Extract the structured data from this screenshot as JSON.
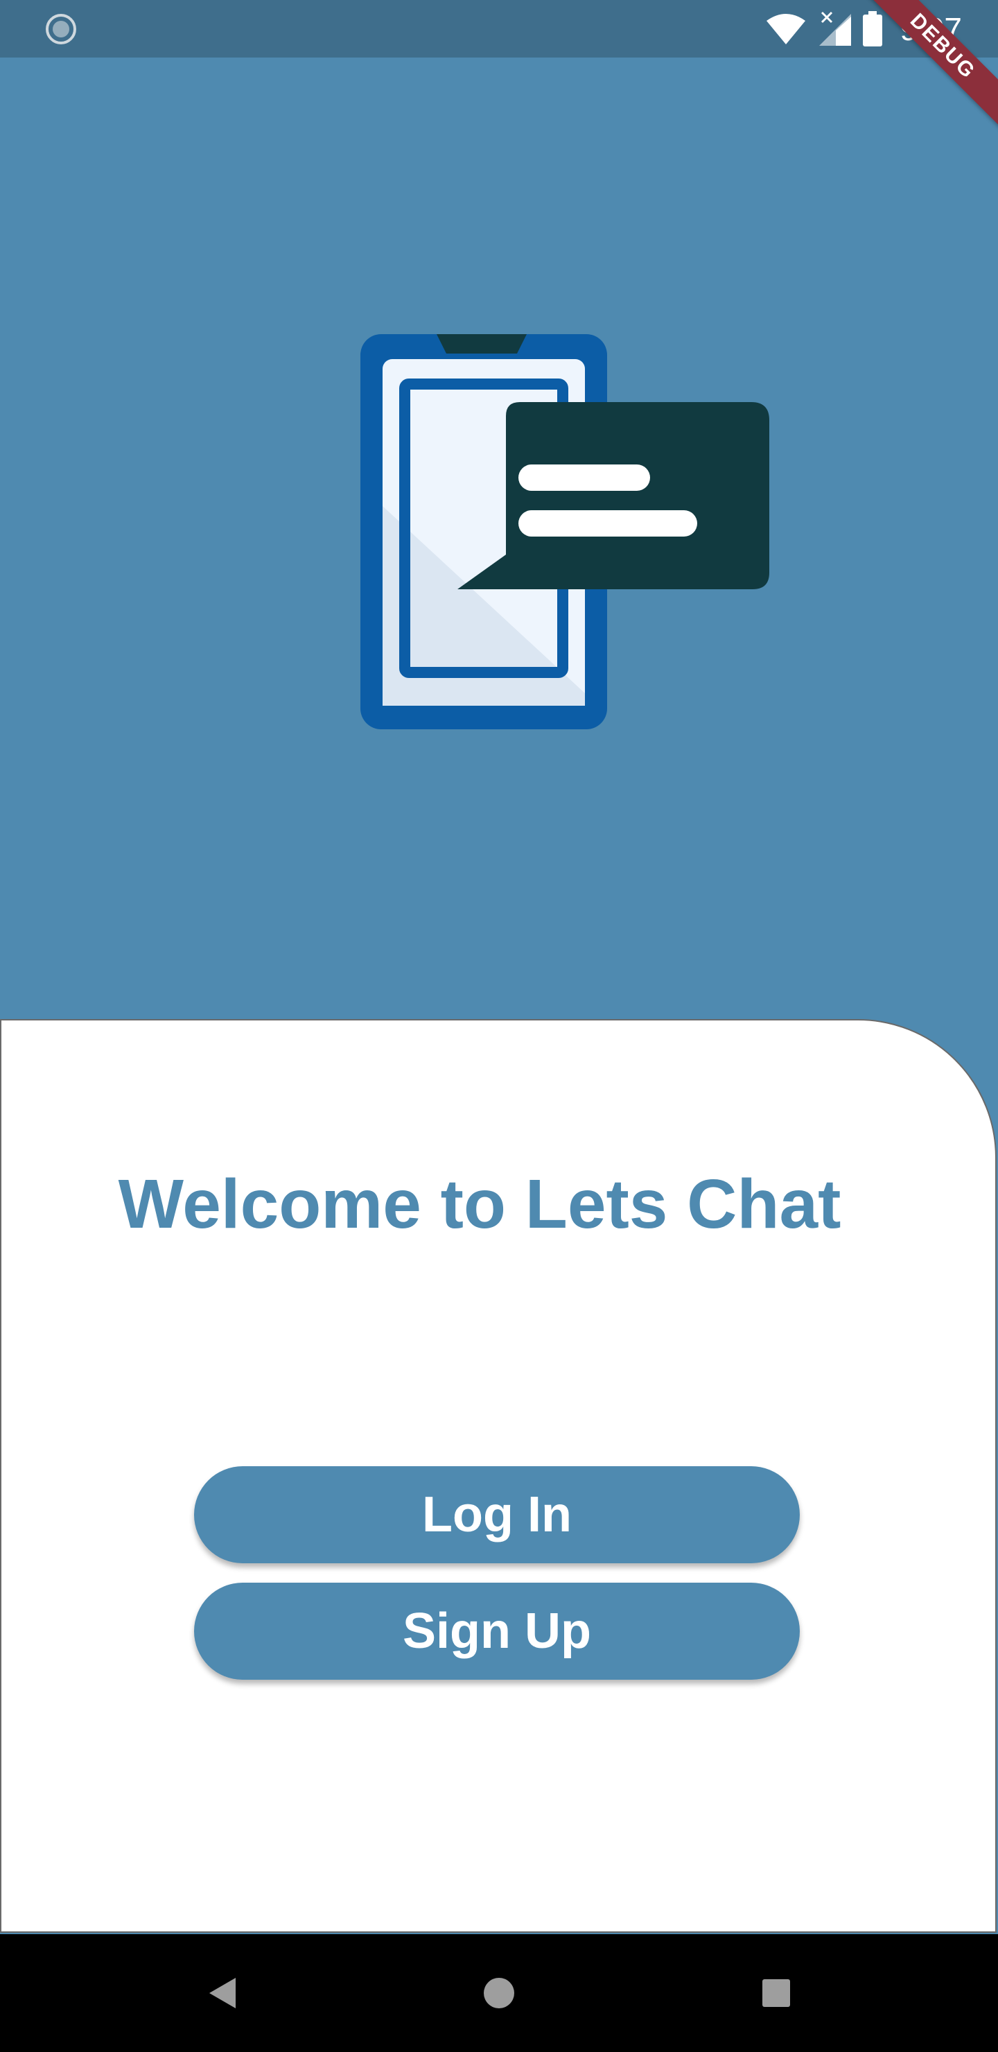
{
  "status_bar": {
    "time": "9:07",
    "left_icon": "loading-circle-icon",
    "icons": [
      "wifi-icon",
      "signal-no-service-icon",
      "battery-icon"
    ]
  },
  "debug_banner": {
    "label": "DEBUG",
    "color": "#8c2f3b"
  },
  "hero": {
    "icon": "phone-chat-illustration-icon"
  },
  "main": {
    "title": "Welcome to Lets Chat",
    "login_label": "Log In",
    "signup_label": "Sign Up"
  },
  "nav_bar": {
    "back": "back-icon",
    "home": "home-icon",
    "recents": "recents-icon"
  },
  "colors": {
    "primary": "#4f8ab0",
    "status_bar": "#3f6e8c",
    "dark_teal": "#113a40",
    "phone_blue": "#0c5da6",
    "background_card": "#ffffff"
  }
}
